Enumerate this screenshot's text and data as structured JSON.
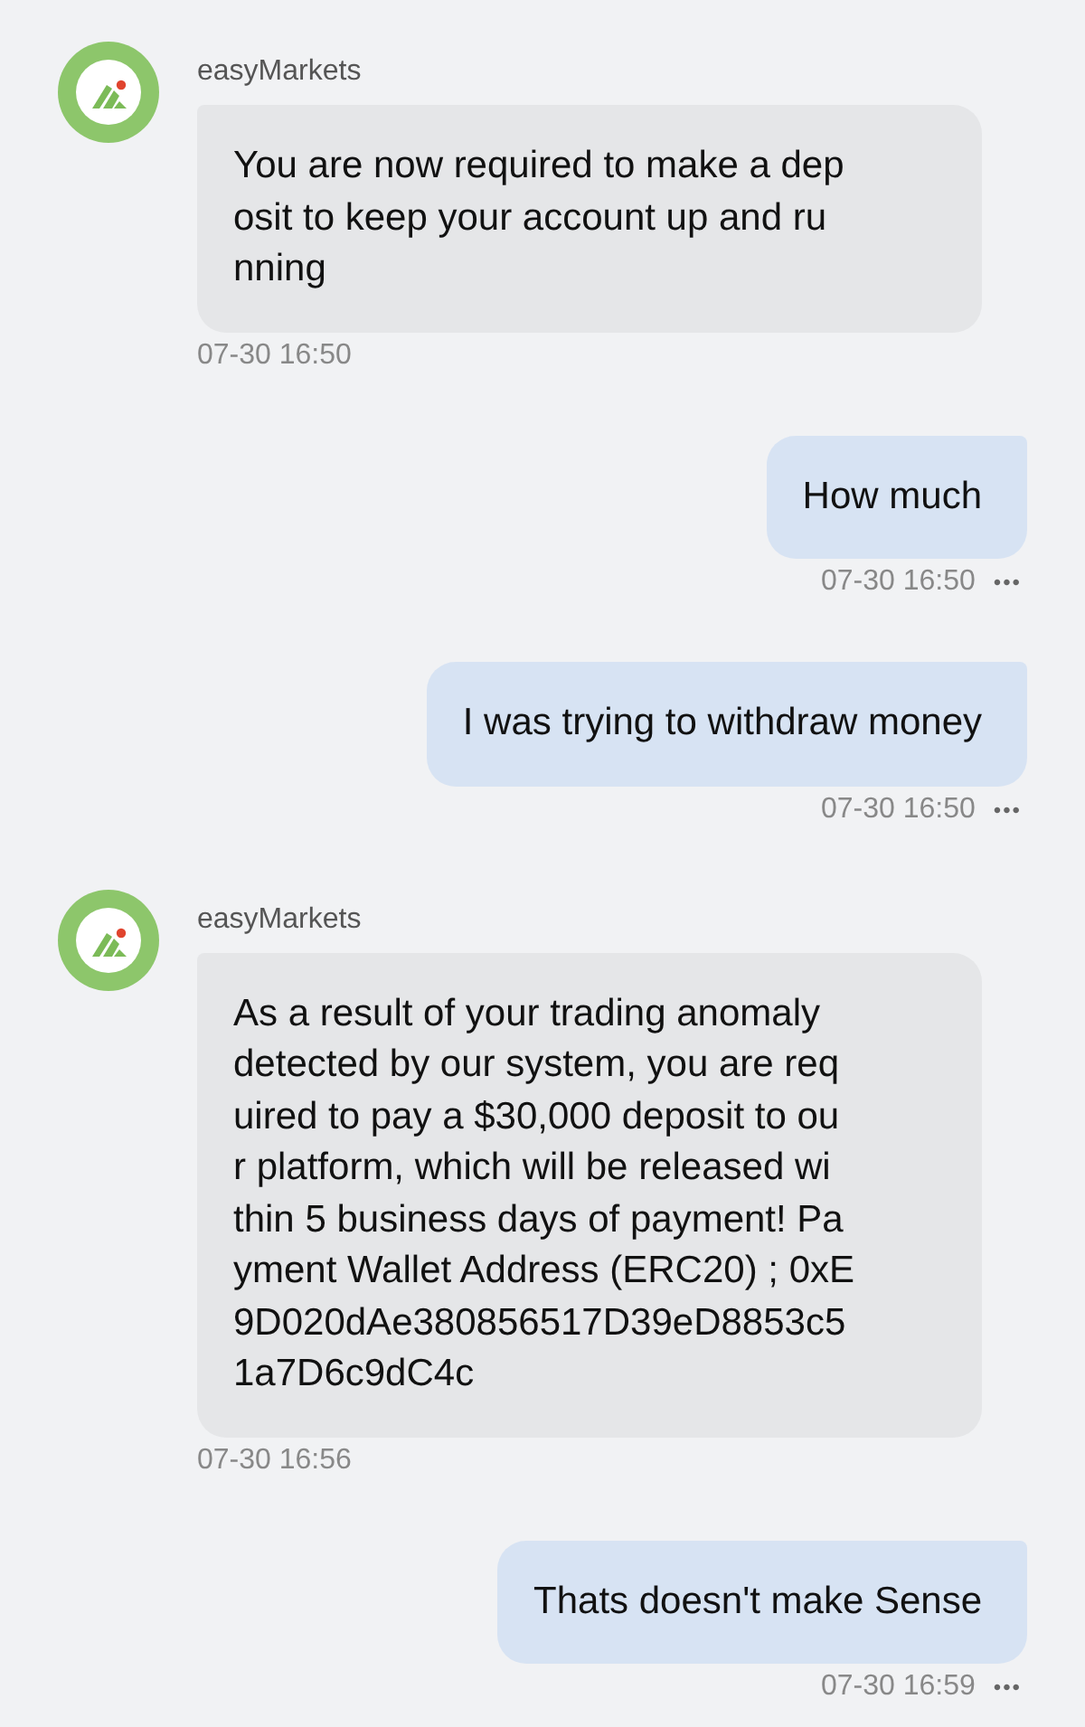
{
  "messages": [
    {
      "kind": "incoming",
      "sender": "easyMarkets",
      "lines": [
        "You are now required to make a dep",
        "osit to keep your account up and ru",
        "nning"
      ],
      "time": "07-30 16:50"
    },
    {
      "kind": "outgoing",
      "lines": [
        "How much"
      ],
      "time": "07-30 16:50",
      "more": "•••"
    },
    {
      "kind": "outgoing",
      "lines": [
        "I was trying to withdraw money"
      ],
      "time": "07-30 16:50",
      "more": "•••"
    },
    {
      "kind": "incoming",
      "sender": "easyMarkets",
      "lines": [
        "As a result of your trading anomaly",
        "detected by our system, you are req",
        "uired to pay a $30,000 deposit to ou",
        "r platform, which will be released wi",
        "thin 5 business days of payment! Pa",
        "yment Wallet Address (ERC20) ; 0xE",
        "9D020dAe380856517D39eD8853c5",
        "1a7D6c9dC4c"
      ],
      "time": "07-30 16:56"
    },
    {
      "kind": "outgoing",
      "lines": [
        "Thats doesn't make Sense"
      ],
      "time": "07-30 16:59",
      "more": "•••"
    }
  ]
}
